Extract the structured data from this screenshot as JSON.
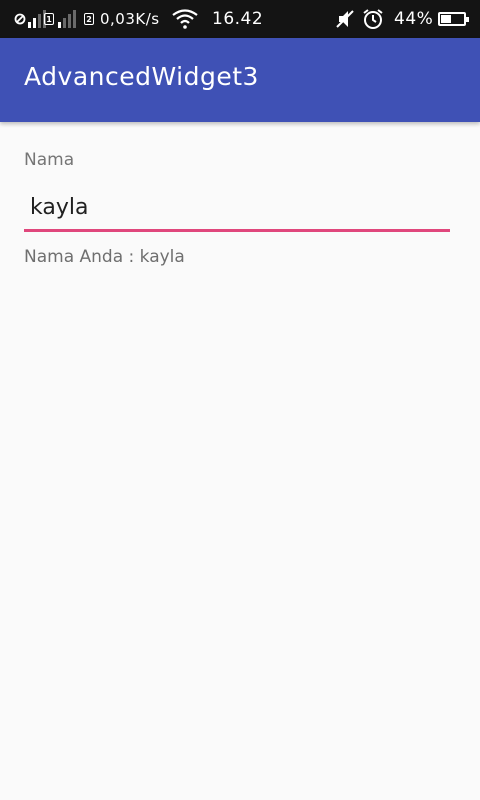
{
  "status_bar": {
    "sim1_label": "1",
    "sim2_label": "2",
    "net_speed": "0,03K/s",
    "time": "16.42",
    "battery_text": "44%",
    "battery_level": 0.44,
    "icons": [
      "no-sim-icon",
      "signal-icon",
      "wifi-icon",
      "mute-icon",
      "alarm-icon",
      "battery-icon"
    ]
  },
  "app_bar": {
    "title": "AdvancedWidget3",
    "color": "#3f51b5"
  },
  "form": {
    "name_label": "Nama",
    "name_value": "kayla",
    "underline_color": "#e0477c",
    "result": "Nama Anda : kayla"
  }
}
